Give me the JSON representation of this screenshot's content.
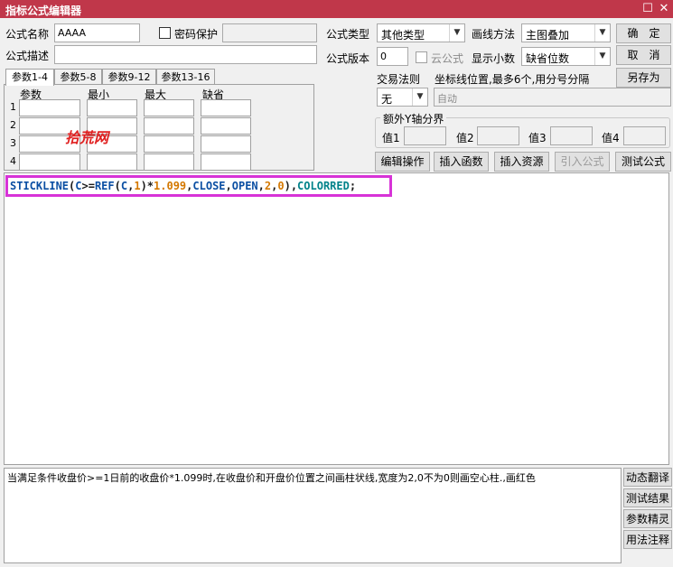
{
  "window": {
    "title": "指标公式编辑器",
    "restore_glyph": "☐",
    "close_glyph": "✕"
  },
  "formula_name": {
    "label": "公式名称",
    "value": "AAAA"
  },
  "password": {
    "label": "密码保护",
    "value": ""
  },
  "formula_desc": {
    "label": "公式描述",
    "value": ""
  },
  "formula_type": {
    "label": "公式类型",
    "value": "其他类型"
  },
  "draw_method": {
    "label": "画线方法",
    "value": "主图叠加"
  },
  "formula_version": {
    "label": "公式版本",
    "value": "0"
  },
  "cloud_formula": {
    "label": "云公式"
  },
  "show_decimals": {
    "label": "显示小数",
    "value": "缺省位数"
  },
  "trade_rule": {
    "label": "交易法则",
    "value": "无"
  },
  "coord_lines": {
    "label": "坐标线位置,最多6个,用分号分隔",
    "value": "自动"
  },
  "y_axis": {
    "label": "额外Y轴分界",
    "fields": [
      "值1",
      "值2",
      "值3",
      "值4"
    ]
  },
  "buttons": {
    "confirm": "确　定",
    "cancel": "取　消",
    "save_as": "另存为",
    "edit_ops": "编辑操作",
    "insert_func": "插入函数",
    "insert_resource": "插入资源",
    "import_formula": "引入公式",
    "test_formula": "测试公式"
  },
  "tabs": [
    "参数1-4",
    "参数5-8",
    "参数9-12",
    "参数13-16"
  ],
  "param_headers": [
    "参数",
    "最小",
    "最大",
    "缺省"
  ],
  "param_rows": [
    "1",
    "2",
    "3",
    "4"
  ],
  "watermark": "拾荒网",
  "code": {
    "t1": "STICKLINE",
    "t2": "(",
    "t3": "C",
    "t4": ">=",
    "t5": "REF",
    "t6": "(",
    "t7": "C",
    "t8": ",",
    "t9": "1",
    "t10": ")*",
    "t11": "1.099",
    "t12": ",",
    "t13": "CLOSE",
    "t14": ",",
    "t15": "OPEN",
    "t16": ",",
    "t17": "2",
    "t18": ",",
    "t19": "0",
    "t20": "),",
    "t21": "COLORRED",
    "t22": ";"
  },
  "description": "当满足条件收盘价>=1日前的收盘价*1.099时,在收盘价和开盘价位置之间画柱状线,宽度为2,0不为0则画空心柱.,画红色",
  "side_buttons": [
    "动态翻译",
    "测试结果",
    "参数精灵",
    "用法注释"
  ],
  "colors": {
    "title_bar": "#c0374a",
    "highlight_border": "#d733d7",
    "function": "#0b4fa3",
    "number": "#d47800",
    "constant": "#00828a",
    "watermark": "#e02020"
  }
}
